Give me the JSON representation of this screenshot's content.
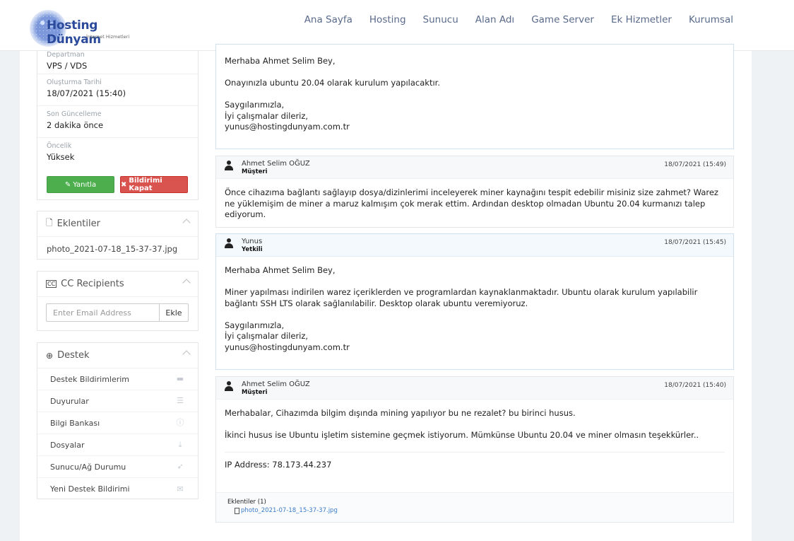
{
  "header": {
    "logo_text": "Hosting Dünyam",
    "logo_sub": "İnternet Hizmetleri",
    "nav": [
      "Ana Sayfa",
      "Hosting",
      "Sunucu",
      "Alan Adı",
      "Game Server",
      "Ek Hizmetler",
      "Kurumsal"
    ]
  },
  "ticket_info": {
    "rows": [
      {
        "label": "Departman",
        "value": "VPS / VDS"
      },
      {
        "label": "Oluşturma Tarihi",
        "value": "18/07/2021 (15:40)"
      },
      {
        "label": "Son Güncelleme",
        "value": "2 dakika önce"
      },
      {
        "label": "Öncelik",
        "value": "Yüksek"
      }
    ],
    "reply_label": "Yanıtla",
    "close_label": "Bildirimi Kapat"
  },
  "attachments": {
    "title": "Eklentiler",
    "items": [
      "photo_2021-07-18_15-37-37.jpg"
    ]
  },
  "cc": {
    "title": "CC Recipients",
    "placeholder": "Enter Email Address",
    "button": "Ekle"
  },
  "support": {
    "title": "Destek",
    "items": [
      {
        "label": "Destek Bildirimlerim",
        "icon": "ticket-icon"
      },
      {
        "label": "Duyurular",
        "icon": "list-icon"
      },
      {
        "label": "Bilgi Bankası",
        "icon": "info-icon"
      },
      {
        "label": "Dosyalar",
        "icon": "download-icon"
      },
      {
        "label": "Sunucu/Ağ Durumu",
        "icon": "rocket-icon"
      },
      {
        "label": "Yeni Destek Bildirimi",
        "icon": "comments-icon"
      }
    ]
  },
  "messages": [
    {
      "name": "",
      "role": "",
      "date": "",
      "paragraphs": [
        "Merhaba Ahmet Selim Bey,",
        "Onayınızla ubuntu 20.04 olarak kurulum yapılacaktır.",
        "Saygılarımızla,\nİyi çalışmalar dileriz,\nyunus@hostingdunyam.com.tr"
      ]
    },
    {
      "name": "Ahmet Selim OĞUZ",
      "role": "Müşteri",
      "date": "18/07/2021 (15:49)",
      "paragraphs": [
        "Önce cihazıma bağlantı sağlayıp dosya/dizinlerimi inceleyerek miner kaynağını tespit edebilir misiniz size zahmet? Warez ne yüklemişim de miner a maruz kalmışım çok merak ettim. Ardından desktop olmadan Ubuntu 20.04 kurmanızı talep ediyorum."
      ]
    },
    {
      "name": "Yunus",
      "role": "Yetkili",
      "date": "18/07/2021 (15:45)",
      "paragraphs": [
        "Merhaba Ahmet Selim Bey,",
        "Miner yapılması indirilen warez içeriklerden ve programlardan kaynaklanmaktadır. Ubuntu olarak kurulum yapılabilir bağlantı SSH LTS olarak sağlanılabilir. Desktop olarak ubuntu veremiyoruz.",
        "Saygılarımızla,\nİyi çalışmalar dileriz,\nyunus@hostingdunyam.com.tr"
      ]
    },
    {
      "name": "Ahmet Selim OĞUZ",
      "role": "Müşteri",
      "date": "18/07/2021 (15:40)",
      "paragraphs": [
        "Merhabalar, Cihazımda bilgim dışında mining yapılıyor bu ne rezalet? bu birinci husus.",
        "İkinci husus ise Ubuntu işletim sistemine geçmek istiyorum. Mümkünse Ubuntu 20.04 ve miner olmasın teşekkürler.."
      ],
      "ip": "IP Address: 78.173.44.237",
      "attachments_label": "Eklentiler (1)",
      "attachment": "photo_2021-07-18_15-37-37.jpg"
    }
  ]
}
